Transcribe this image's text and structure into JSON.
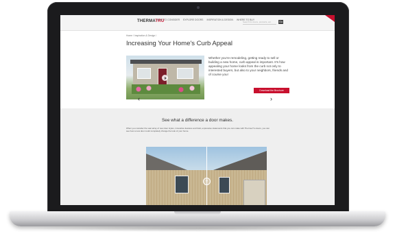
{
  "site": {
    "logo_text_a": "THERMA",
    "logo_text_b": "TRU",
    "nav_items": [
      "WHAT TO CONSIDER",
      "EXPLORE DOORS",
      "INSPIRATION & DESIGN",
      "WHERE TO BUY"
    ],
    "search_placeholder": "Search for doors, products, etc.",
    "search_button": "Go",
    "accent_color": "#c8102e"
  },
  "content": {
    "breadcrumb": "Home / Inspiration & Design /",
    "page_title": "Increasing Your Home's Curb Appeal",
    "intro_text": "Whether you're remodeling, getting ready to sell or building a new home, curb appeal is important. It's how appealing your home looks from the curb not only to interested buyers, but also to your neighbors, friends and of course you!",
    "download_button": "Download the Brochure",
    "hero_media": "video-thumbnail-house",
    "play_icon": "play-icon"
  },
  "comparison": {
    "heading": "See what a difference a door makes.",
    "body": "When you consider the vast array of new door styles, innovative features and bold, expressive statements that you can make with Therma-Tru doors, you can see how a new door could completely change the look of your home.",
    "prev_arrow": "‹",
    "next_arrow": "›",
    "handle_glyph": "‹›"
  }
}
